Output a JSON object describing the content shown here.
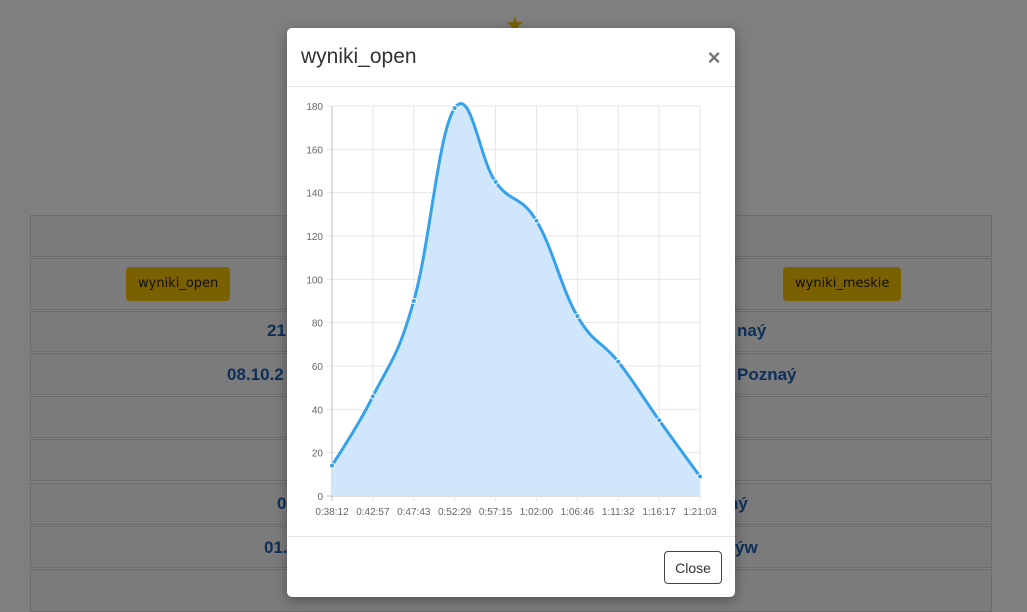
{
  "background": {
    "buttons": [
      {
        "label": "wyniki_open"
      },
      {
        "label": "wyniki_meskie"
      }
    ],
    "rows": [
      {
        "left": "21",
        "right": "naý"
      },
      {
        "left": "08.10.2",
        "right": "Poznaý"
      },
      {
        "left": "0",
        "right": "ný"
      },
      {
        "left": "01.",
        "right": "ýw"
      }
    ]
  },
  "modal": {
    "title": "wyniki_open",
    "close_symbol": "×",
    "close_button_label": "Close"
  },
  "chart_data": {
    "type": "area",
    "title": "",
    "xlabel": "",
    "ylabel": "",
    "x": [
      "0:38:12",
      "0:42:57",
      "0:47:43",
      "0:52:29",
      "0:57:15",
      "1:02:00",
      "1:06:46",
      "1:11:32",
      "1:16:17",
      "1:21:03"
    ],
    "series": [
      {
        "values": [
          14,
          46,
          90,
          179,
          145,
          127,
          83,
          62,
          35,
          9
        ]
      }
    ],
    "ylim": [
      0,
      180
    ],
    "yticks": [
      0,
      20,
      40,
      60,
      80,
      100,
      120,
      140,
      160,
      180
    ],
    "grid": true,
    "line_color": "#36a2eb",
    "fill_color": "#cfe6fb"
  }
}
